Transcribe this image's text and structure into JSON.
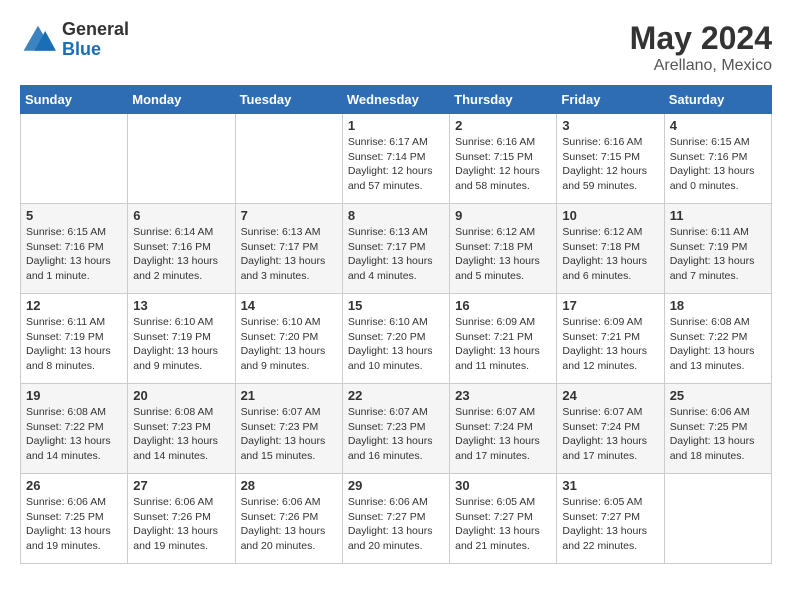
{
  "header": {
    "logo_general": "General",
    "logo_blue": "Blue",
    "title": "May 2024",
    "location": "Arellano, Mexico"
  },
  "weekdays": [
    "Sunday",
    "Monday",
    "Tuesday",
    "Wednesday",
    "Thursday",
    "Friday",
    "Saturday"
  ],
  "weeks": [
    [
      {
        "day": "",
        "info": ""
      },
      {
        "day": "",
        "info": ""
      },
      {
        "day": "",
        "info": ""
      },
      {
        "day": "1",
        "info": "Sunrise: 6:17 AM\nSunset: 7:14 PM\nDaylight: 12 hours\nand 57 minutes."
      },
      {
        "day": "2",
        "info": "Sunrise: 6:16 AM\nSunset: 7:15 PM\nDaylight: 12 hours\nand 58 minutes."
      },
      {
        "day": "3",
        "info": "Sunrise: 6:16 AM\nSunset: 7:15 PM\nDaylight: 12 hours\nand 59 minutes."
      },
      {
        "day": "4",
        "info": "Sunrise: 6:15 AM\nSunset: 7:16 PM\nDaylight: 13 hours\nand 0 minutes."
      }
    ],
    [
      {
        "day": "5",
        "info": "Sunrise: 6:15 AM\nSunset: 7:16 PM\nDaylight: 13 hours\nand 1 minute."
      },
      {
        "day": "6",
        "info": "Sunrise: 6:14 AM\nSunset: 7:16 PM\nDaylight: 13 hours\nand 2 minutes."
      },
      {
        "day": "7",
        "info": "Sunrise: 6:13 AM\nSunset: 7:17 PM\nDaylight: 13 hours\nand 3 minutes."
      },
      {
        "day": "8",
        "info": "Sunrise: 6:13 AM\nSunset: 7:17 PM\nDaylight: 13 hours\nand 4 minutes."
      },
      {
        "day": "9",
        "info": "Sunrise: 6:12 AM\nSunset: 7:18 PM\nDaylight: 13 hours\nand 5 minutes."
      },
      {
        "day": "10",
        "info": "Sunrise: 6:12 AM\nSunset: 7:18 PM\nDaylight: 13 hours\nand 6 minutes."
      },
      {
        "day": "11",
        "info": "Sunrise: 6:11 AM\nSunset: 7:19 PM\nDaylight: 13 hours\nand 7 minutes."
      }
    ],
    [
      {
        "day": "12",
        "info": "Sunrise: 6:11 AM\nSunset: 7:19 PM\nDaylight: 13 hours\nand 8 minutes."
      },
      {
        "day": "13",
        "info": "Sunrise: 6:10 AM\nSunset: 7:19 PM\nDaylight: 13 hours\nand 9 minutes."
      },
      {
        "day": "14",
        "info": "Sunrise: 6:10 AM\nSunset: 7:20 PM\nDaylight: 13 hours\nand 9 minutes."
      },
      {
        "day": "15",
        "info": "Sunrise: 6:10 AM\nSunset: 7:20 PM\nDaylight: 13 hours\nand 10 minutes."
      },
      {
        "day": "16",
        "info": "Sunrise: 6:09 AM\nSunset: 7:21 PM\nDaylight: 13 hours\nand 11 minutes."
      },
      {
        "day": "17",
        "info": "Sunrise: 6:09 AM\nSunset: 7:21 PM\nDaylight: 13 hours\nand 12 minutes."
      },
      {
        "day": "18",
        "info": "Sunrise: 6:08 AM\nSunset: 7:22 PM\nDaylight: 13 hours\nand 13 minutes."
      }
    ],
    [
      {
        "day": "19",
        "info": "Sunrise: 6:08 AM\nSunset: 7:22 PM\nDaylight: 13 hours\nand 14 minutes."
      },
      {
        "day": "20",
        "info": "Sunrise: 6:08 AM\nSunset: 7:23 PM\nDaylight: 13 hours\nand 14 minutes."
      },
      {
        "day": "21",
        "info": "Sunrise: 6:07 AM\nSunset: 7:23 PM\nDaylight: 13 hours\nand 15 minutes."
      },
      {
        "day": "22",
        "info": "Sunrise: 6:07 AM\nSunset: 7:23 PM\nDaylight: 13 hours\nand 16 minutes."
      },
      {
        "day": "23",
        "info": "Sunrise: 6:07 AM\nSunset: 7:24 PM\nDaylight: 13 hours\nand 17 minutes."
      },
      {
        "day": "24",
        "info": "Sunrise: 6:07 AM\nSunset: 7:24 PM\nDaylight: 13 hours\nand 17 minutes."
      },
      {
        "day": "25",
        "info": "Sunrise: 6:06 AM\nSunset: 7:25 PM\nDaylight: 13 hours\nand 18 minutes."
      }
    ],
    [
      {
        "day": "26",
        "info": "Sunrise: 6:06 AM\nSunset: 7:25 PM\nDaylight: 13 hours\nand 19 minutes."
      },
      {
        "day": "27",
        "info": "Sunrise: 6:06 AM\nSunset: 7:26 PM\nDaylight: 13 hours\nand 19 minutes."
      },
      {
        "day": "28",
        "info": "Sunrise: 6:06 AM\nSunset: 7:26 PM\nDaylight: 13 hours\nand 20 minutes."
      },
      {
        "day": "29",
        "info": "Sunrise: 6:06 AM\nSunset: 7:27 PM\nDaylight: 13 hours\nand 20 minutes."
      },
      {
        "day": "30",
        "info": "Sunrise: 6:05 AM\nSunset: 7:27 PM\nDaylight: 13 hours\nand 21 minutes."
      },
      {
        "day": "31",
        "info": "Sunrise: 6:05 AM\nSunset: 7:27 PM\nDaylight: 13 hours\nand 22 minutes."
      },
      {
        "day": "",
        "info": ""
      }
    ]
  ]
}
